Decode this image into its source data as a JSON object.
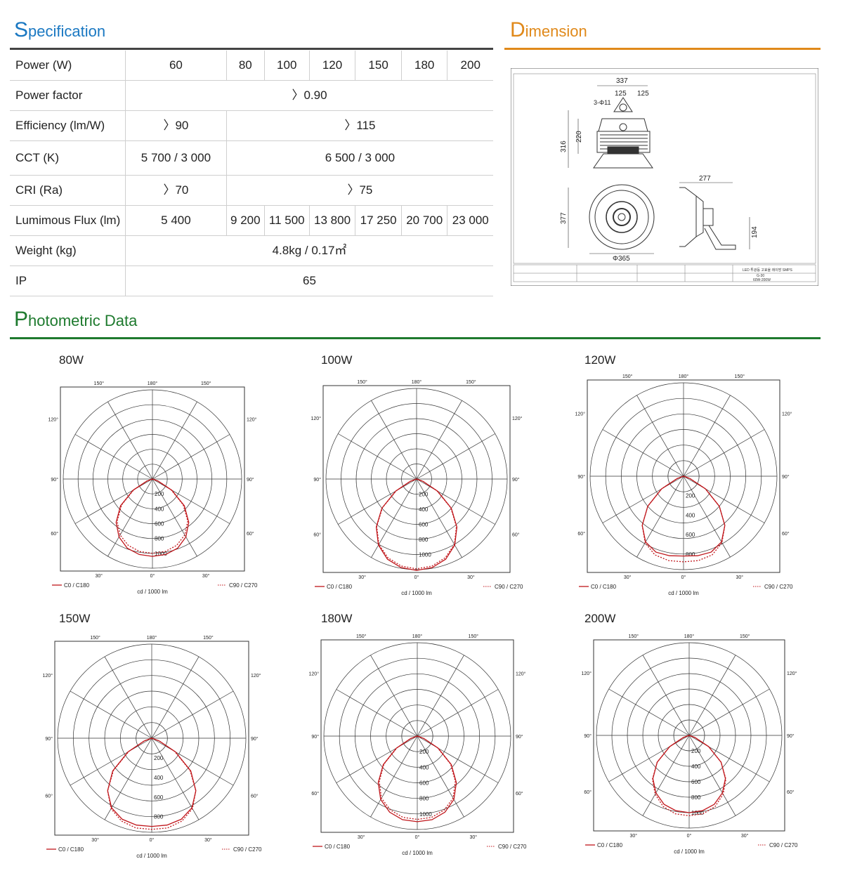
{
  "spec": {
    "title_cap": "S",
    "title_rest": "pecification",
    "color": "#1a78c2",
    "rows": [
      {
        "label": "Power (W)",
        "cells": [
          {
            "text": "60",
            "span": 1
          },
          {
            "text": "80",
            "span": 1
          },
          {
            "text": "100",
            "span": 1
          },
          {
            "text": "120",
            "span": 1
          },
          {
            "text": "150",
            "span": 1
          },
          {
            "text": "180",
            "span": 1
          },
          {
            "text": "200",
            "span": 1
          }
        ]
      },
      {
        "label": "Power factor",
        "cells": [
          {
            "text": "〉0.90",
            "span": 7
          }
        ]
      },
      {
        "label": "Efficiency (lm/W)",
        "cells": [
          {
            "text": "〉90",
            "span": 1
          },
          {
            "text": "〉115",
            "span": 6
          }
        ]
      },
      {
        "label": "CCT (K)",
        "cells": [
          {
            "text": "5 700 / 3 000",
            "span": 1
          },
          {
            "text": "6 500 / 3 000",
            "span": 6
          }
        ]
      },
      {
        "label": "CRI (Ra)",
        "cells": [
          {
            "text": "〉70",
            "span": 1
          },
          {
            "text": "〉75",
            "span": 6
          }
        ]
      },
      {
        "label": "Lumimous Flux (lm)",
        "cells": [
          {
            "text": "5 400",
            "span": 1
          },
          {
            "text": "9 200",
            "span": 1
          },
          {
            "text": "11 500",
            "span": 1
          },
          {
            "text": "13 800",
            "span": 1
          },
          {
            "text": "17 250",
            "span": 1
          },
          {
            "text": "20 700",
            "span": 1
          },
          {
            "text": "23 000",
            "span": 1
          }
        ]
      },
      {
        "label": "Weight (kg)",
        "cells": [
          {
            "text": "4.8kg / 0.17㎡",
            "span": 7
          }
        ]
      },
      {
        "label": "IP",
        "cells": [
          {
            "text": "65",
            "span": 7
          }
        ]
      }
    ]
  },
  "dimension": {
    "title_cap": "D",
    "title_rest": "imension",
    "color": "#e0891a",
    "labels": {
      "top_width": "337",
      "flange_a": "125",
      "flange_b": "125",
      "hole": "3-Φ11",
      "height_total": "316",
      "height_body": "220",
      "diameter_h": "377",
      "diameter": "Φ365",
      "side_width": "277",
      "side_height": "194"
    },
    "title_block": {
      "product": "LED 투광등 고효율 레이방 SMPS",
      "model": "G-30",
      "range": "60W-200W"
    }
  },
  "photometric": {
    "title_cap": "P",
    "title_rest": "hotometric Data",
    "color": "#1e7a2e",
    "legend_c0": "C0 / C180",
    "legend_c90": "C90 / C270",
    "unit": "cd / 1000 lm",
    "angle_labels": {
      "a180": "180°",
      "a150": "150°",
      "a120": "120°",
      "a90": "90°",
      "a60": "60°",
      "a30": "30°",
      "a0": "0°"
    },
    "c0_color": "#c0161b",
    "c90_color": "#c0161b",
    "charts": [
      {
        "title": "80W",
        "ticks": [
          "200",
          "400",
          "600",
          "800",
          "1000"
        ],
        "rmax": 1000,
        "c0": [
          1040,
          1030,
          990,
          900,
          760,
          560,
          300,
          80,
          0
        ],
        "c90": [
          1000,
          990,
          950,
          870,
          740,
          540,
          290,
          80,
          0
        ]
      },
      {
        "title": "100W",
        "ticks": [
          "200",
          "400",
          "600",
          "800",
          "1000"
        ],
        "rmax": 1000,
        "c0": [
          1210,
          1190,
          1130,
          1010,
          830,
          600,
          320,
          90,
          0
        ],
        "c90": [
          1190,
          1170,
          1110,
          1000,
          820,
          590,
          310,
          90,
          0
        ]
      },
      {
        "title": "120W",
        "ticks": [
          "200",
          "400",
          "600",
          "800"
        ],
        "rmax": 800,
        "c0": [
          820,
          830,
          830,
          780,
          660,
          480,
          260,
          70,
          0
        ],
        "c90": [
          880,
          880,
          860,
          790,
          660,
          480,
          260,
          70,
          0
        ]
      },
      {
        "title": "150W",
        "ticks": [
          "200",
          "400",
          "600",
          "800"
        ],
        "rmax": 800,
        "c0": [
          900,
          900,
          880,
          820,
          700,
          520,
          280,
          80,
          0
        ],
        "c90": [
          930,
          930,
          900,
          830,
          700,
          510,
          270,
          80,
          0
        ]
      },
      {
        "title": "180W",
        "ticks": [
          "200",
          "400",
          "600",
          "800",
          "1000"
        ],
        "rmax": 1000,
        "c0": [
          1100,
          1090,
          1040,
          940,
          780,
          570,
          310,
          90,
          0
        ],
        "c90": [
          1070,
          1060,
          1010,
          920,
          760,
          560,
          300,
          90,
          0
        ]
      },
      {
        "title": "200W",
        "ticks": [
          "200",
          "400",
          "600",
          "800",
          "1000"
        ],
        "rmax": 1000,
        "c0": [
          1000,
          990,
          950,
          860,
          730,
          540,
          290,
          80,
          0
        ],
        "c90": [
          1040,
          1030,
          980,
          880,
          740,
          540,
          290,
          80,
          0
        ]
      }
    ]
  }
}
